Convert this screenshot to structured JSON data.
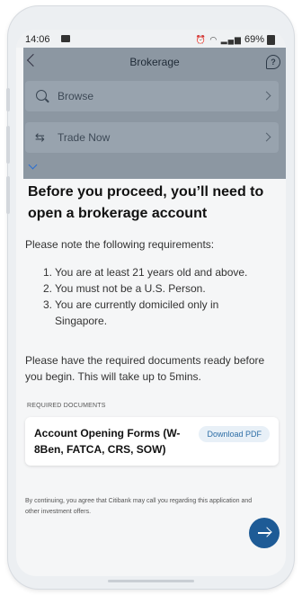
{
  "status": {
    "time": "14:06",
    "battery": "69%",
    "icons": [
      "alarm-icon",
      "wifi-icon",
      "volte-icon",
      "signal-icon",
      "battery-icon"
    ]
  },
  "nav": {
    "title": "Brokerage",
    "menu": [
      {
        "label": "Browse",
        "icon": "search-icon"
      },
      {
        "label": "Trade Now",
        "icon": "trade-arrows-icon"
      }
    ]
  },
  "sheet": {
    "heading": "Before you proceed, you’ll need to open a brokerage account",
    "intro": "Please note the following requirements:",
    "requirements": [
      {
        "num": "1.",
        "text": "You are at least 21 years old and above."
      },
      {
        "num": "2.",
        "text": "You must not be a U.S. Person."
      },
      {
        "num": "3.",
        "text": "You are currently domiciled only in Singapore."
      }
    ],
    "documents_note": "Please have the required documents ready before you begin. This will take up to 5mins.",
    "section_label": "REQUIRED DOCUMENTS",
    "document": {
      "title": "Account Opening Forms (W-8Ben, FATCA, CRS, SOW)",
      "button": "Download PDF"
    },
    "footer": "By continuing, you agree that Citibank may call you regarding this application and other investment offers."
  },
  "colors": {
    "accent": "#1e5b96",
    "overlay": "#8c97a2",
    "link": "#2d6ea6"
  }
}
